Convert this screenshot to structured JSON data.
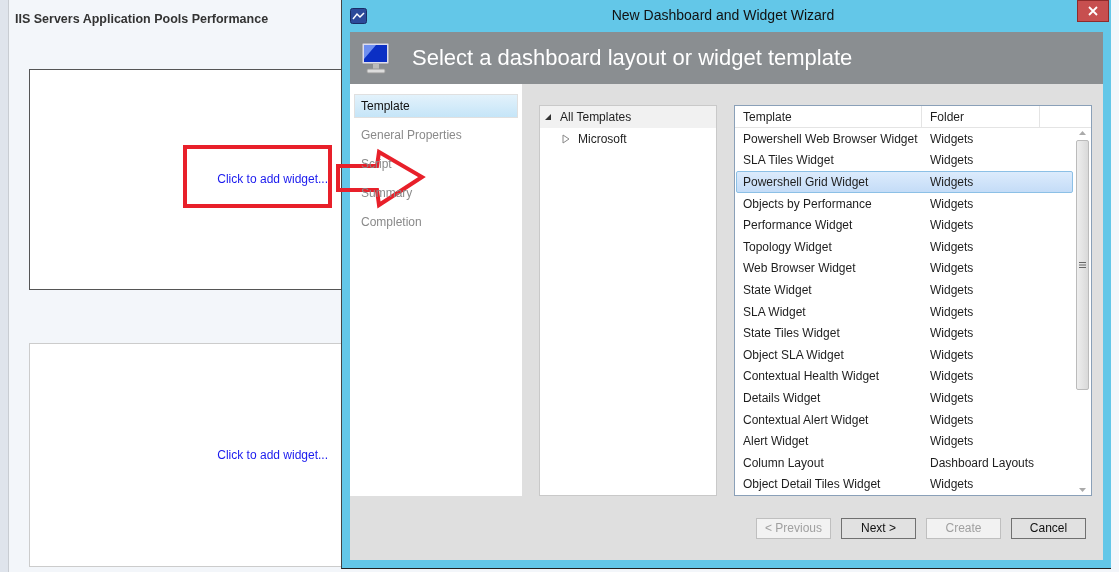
{
  "background_window": {
    "title": "IIS Servers Application Pools Performance",
    "widget_slots": [
      {
        "link": "Click to add widget...",
        "highlighted": true
      },
      {
        "link": "Click to add widget...",
        "highlighted": false
      }
    ]
  },
  "dialog": {
    "title": "New Dashboard and Widget Wizard",
    "heading": "Select a dashboard layout or widget template",
    "steps": [
      {
        "label": "Template",
        "selected": true
      },
      {
        "label": "General Properties",
        "selected": false
      },
      {
        "label": "Script",
        "selected": false
      },
      {
        "label": "Summary",
        "selected": false
      },
      {
        "label": "Completion",
        "selected": false
      }
    ],
    "tree": [
      {
        "label": "All Templates",
        "expanded": true,
        "children": [
          {
            "label": "Microsoft",
            "expanded": false
          }
        ]
      }
    ],
    "table": {
      "columns": [
        "Template",
        "Folder"
      ],
      "rows": [
        {
          "template": "Powershell Web Browser Widget",
          "folder": "Widgets",
          "selected": false
        },
        {
          "template": "SLA Tiles Widget",
          "folder": "Widgets",
          "selected": false
        },
        {
          "template": "Powershell Grid Widget",
          "folder": "Widgets",
          "selected": true
        },
        {
          "template": "Objects by Performance",
          "folder": "Widgets",
          "selected": false
        },
        {
          "template": "Performance Widget",
          "folder": "Widgets",
          "selected": false
        },
        {
          "template": "Topology Widget",
          "folder": "Widgets",
          "selected": false
        },
        {
          "template": "Web Browser Widget",
          "folder": "Widgets",
          "selected": false
        },
        {
          "template": "State Widget",
          "folder": "Widgets",
          "selected": false
        },
        {
          "template": "SLA Widget",
          "folder": "Widgets",
          "selected": false
        },
        {
          "template": "State Tiles Widget",
          "folder": "Widgets",
          "selected": false
        },
        {
          "template": "Object SLA Widget",
          "folder": "Widgets",
          "selected": false
        },
        {
          "template": "Contextual Health Widget",
          "folder": "Widgets",
          "selected": false
        },
        {
          "template": "Details Widget",
          "folder": "Widgets",
          "selected": false
        },
        {
          "template": "Contextual Alert Widget",
          "folder": "Widgets",
          "selected": false
        },
        {
          "template": "Alert Widget",
          "folder": "Widgets",
          "selected": false
        },
        {
          "template": "Column Layout",
          "folder": "Dashboard Layouts",
          "selected": false
        },
        {
          "template": "Object Detail Tiles Widget",
          "folder": "Widgets",
          "selected": false
        }
      ]
    },
    "buttons": [
      {
        "label": "< Previous",
        "disabled": true
      },
      {
        "label": "Next >",
        "disabled": false
      },
      {
        "label": "Create",
        "disabled": true
      },
      {
        "label": "Cancel",
        "disabled": false
      }
    ]
  }
}
